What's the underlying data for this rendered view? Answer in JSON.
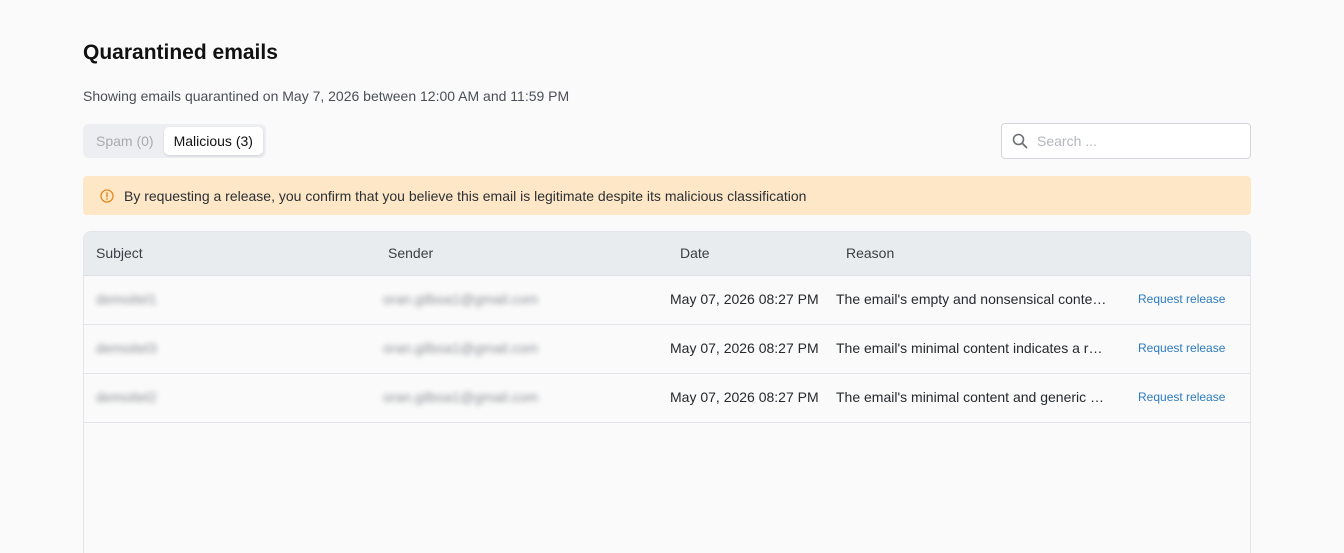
{
  "page": {
    "title": "Quarantined emails",
    "subtitle": "Showing emails quarantined on May 7, 2026 between 12:00 AM and 11:59 PM"
  },
  "tabs": [
    {
      "label": "Spam (0)",
      "active": false
    },
    {
      "label": "Malicious (3)",
      "active": true
    }
  ],
  "search": {
    "placeholder": "Search ...",
    "value": "",
    "icon": "search-icon"
  },
  "alert": {
    "icon": "warning-circle-icon",
    "text": "By requesting a release, you confirm that you believe this email is legitimate despite its malicious classification",
    "background": "#fde7c7",
    "icon_color": "#e08a1e"
  },
  "table": {
    "columns": [
      "Subject",
      "Sender",
      "Date",
      "Reason"
    ],
    "rows": [
      {
        "subject": "demoitel1",
        "sender": "oran.gilboa1@gmail.com",
        "date": "May 07, 2026 08:27 PM",
        "reason": "The email's empty and nonsensical conte…",
        "action": "Request release"
      },
      {
        "subject": "demoitel3",
        "sender": "oran.gilboa1@gmail.com",
        "date": "May 07, 2026 08:27 PM",
        "reason": "The email's minimal content indicates a re…",
        "action": "Request release"
      },
      {
        "subject": "demoitel2",
        "sender": "oran.gilboa1@gmail.com",
        "date": "May 07, 2026 08:27 PM",
        "reason": "The email's minimal content and generic s…",
        "action": "Request release"
      }
    ]
  },
  "colors": {
    "link": "#2c7bc0",
    "header_bg": "#e9ecef",
    "page_bg": "#fafafa"
  }
}
